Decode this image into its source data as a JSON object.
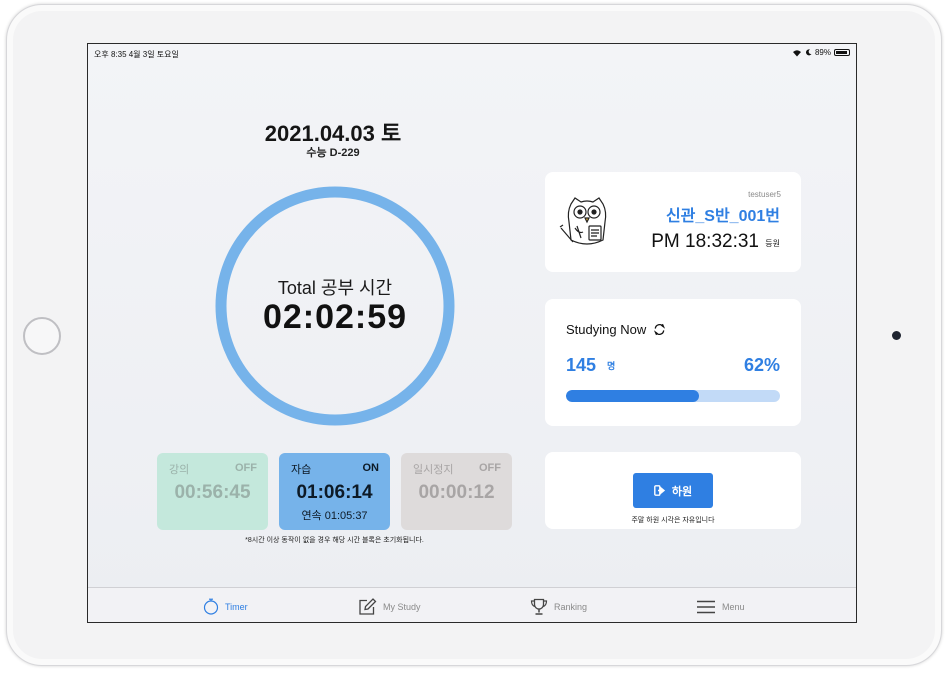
{
  "status_bar": {
    "time_date": "오후 8:35   4월 3일 토요일",
    "battery": "89%"
  },
  "header": {
    "date": "2021.04.03 토",
    "dday": "수능 D-229"
  },
  "total": {
    "label": "Total 공부 시간",
    "time": "02:02:59"
  },
  "timers": [
    {
      "name": "강의",
      "state": "OFF",
      "time": "00:56:45"
    },
    {
      "name": "자습",
      "state": "ON",
      "time": "01:06:14",
      "sub": "연속  01:05:37"
    },
    {
      "name": "일시정지",
      "state": "OFF",
      "time": "00:00:12"
    }
  ],
  "reset_note": "*8시간 이상 동작이 없을 경우 해당 시간 블록은 초기화됩니다.",
  "profile": {
    "username": "testuser5",
    "class_name": "신관_S반_001번",
    "clock_time": "PM 18:32:31",
    "clock_suffix": "등원"
  },
  "studying_now": {
    "title": "Studying Now",
    "count": "145",
    "unit": "명",
    "percent_label": "62%",
    "ratio": 0.62
  },
  "checkout": {
    "button_label": "하원",
    "note": "주말 하원 시각은 자유입니다"
  },
  "tabs": [
    {
      "label": "Timer",
      "icon": "stopwatch-icon",
      "active": true
    },
    {
      "label": "My Study",
      "icon": "pencil-square-icon",
      "active": false
    },
    {
      "label": "Ranking",
      "icon": "trophy-icon",
      "active": false
    },
    {
      "label": "Menu",
      "icon": "hamburger-menu-icon",
      "active": false
    }
  ],
  "colors": {
    "accent": "#2f7fe2",
    "ring": "#76b3ea",
    "lecture_box": "#c4e8dc",
    "self_study_box": "#76b3ea",
    "pause_box": "#dedbdb"
  }
}
